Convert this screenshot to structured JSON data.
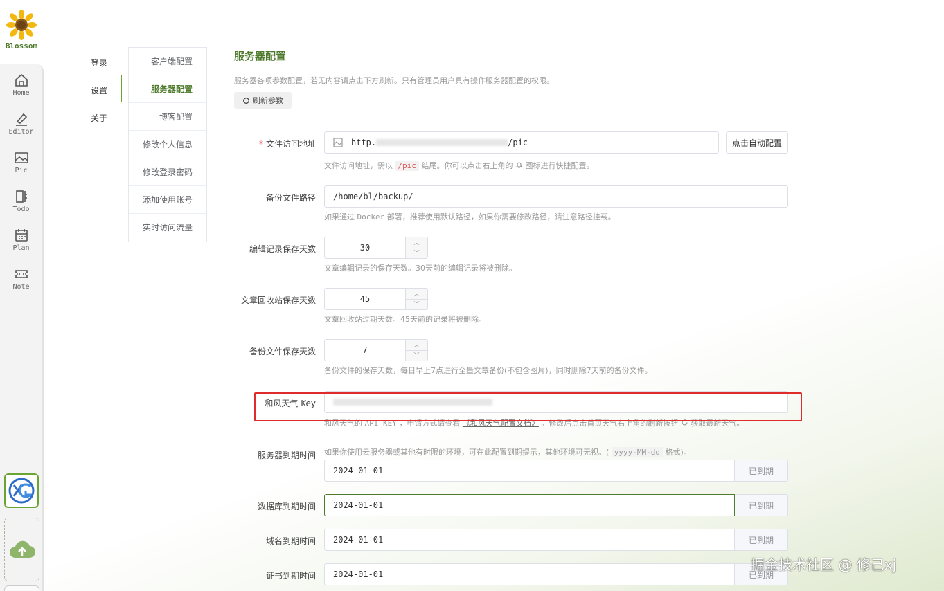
{
  "app": {
    "name": "Blossom"
  },
  "nav": [
    {
      "label": "Home",
      "icon": "home-icon"
    },
    {
      "label": "Editor",
      "icon": "editor-icon"
    },
    {
      "label": "Pic",
      "icon": "picture-icon"
    },
    {
      "label": "Todo",
      "icon": "todo-icon"
    },
    {
      "label": "Plan",
      "icon": "calendar-icon"
    },
    {
      "label": "Note",
      "icon": "ticket-icon"
    }
  ],
  "categories": {
    "login": "登录",
    "settings": "设置",
    "about": "关于"
  },
  "submenu": [
    {
      "label": "客户端配置",
      "active": false
    },
    {
      "label": "服务器配置",
      "active": true
    },
    {
      "label": "博客配置",
      "active": false
    },
    {
      "label": "修改个人信息",
      "active": false
    },
    {
      "label": "修改登录密码",
      "active": false
    },
    {
      "label": "添加使用账号",
      "active": false
    },
    {
      "label": "实时访问流量",
      "active": false
    }
  ],
  "page": {
    "title": "服务器配置",
    "desc": "服务器各项参数配置，若无内容请点击下方刷新。只有管理员用户具有操作服务器配置的权限。",
    "refresh_label": "刷新参数"
  },
  "form": {
    "file_url": {
      "label": "文件访问地址",
      "value_prefix": "http.",
      "value_suffix": "/pic",
      "auto_btn": "点击自动配置",
      "hint_a": "文件访问地址，需以",
      "hint_code": "/pic",
      "hint_b": "结尾。你可以点击右上角的",
      "hint_c": "图标进行快捷配置。"
    },
    "backup_path": {
      "label": "备份文件路径",
      "value": "/home/bl/backup/",
      "hint_a": "如果通过",
      "hint_code": "Docker",
      "hint_b": "部署，推荐使用默认路径，如果你需要修改路径，请注意路径挂载。"
    },
    "edit_days": {
      "label": "编辑记录保存天数",
      "value": "30",
      "hint": "文章编辑记录的保存天数。30天前的编辑记录将被删除。"
    },
    "recycle_days": {
      "label": "文章回收站保存天数",
      "value": "45",
      "hint": "文章回收站过期天数。45天前的记录将被删除。"
    },
    "backup_days": {
      "label": "备份文件保存天数",
      "value": "7",
      "hint": "备份文件的保存天数，每日早上7点进行全量文章备份(不包含图片)，同时删除7天前的备份文件。"
    },
    "weather_key": {
      "label": "和风天气 Key",
      "hint_a": "和风天气的",
      "hint_code": "API KEY",
      "hint_b": "，申请方式请查看",
      "hint_link": "《和风天气配置文档》",
      "hint_c": "。修改后点击首页天气右上角的刷新按钮",
      "hint_d": "获取最新天气。"
    },
    "server_expire": {
      "label": "服务器到期时间",
      "hint_a": "如果你使用云服务器或其他有时限的环境，可在此配置到期提示，其他环境可无视。(",
      "hint_code": "yyyy-MM-dd",
      "hint_b": "格式)。",
      "value": "2024-01-01",
      "status": "已到期"
    },
    "db_expire": {
      "label": "数据库到期时间",
      "value": "2024-01-01",
      "status": "已到期"
    },
    "domain_expire": {
      "label": "域名到期时间",
      "value": "2024-01-01",
      "status": "已到期"
    },
    "cert_expire": {
      "label": "证书到期时间",
      "value": "2024-01-01",
      "status": "已到期"
    }
  },
  "watermark": "掘金技术社区 @ 修己xj",
  "colors": {
    "accent": "#4e7a2c",
    "highlight_box": "#e02b2b",
    "required": "#f56c6c"
  }
}
